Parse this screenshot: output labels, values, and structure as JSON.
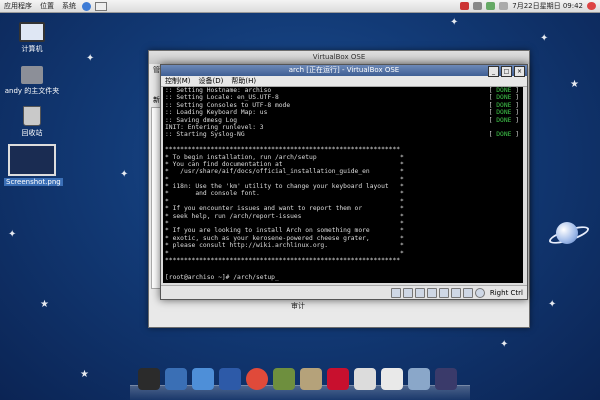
{
  "panel": {
    "menus": [
      "应用程序",
      "位置",
      "系统"
    ],
    "datetime": "7月22日星期日 09:42"
  },
  "desktop": {
    "icons": [
      {
        "label": "计算机",
        "icon": "computer-icon"
      },
      {
        "label": "andy 的主文件夹",
        "icon": "home-folder-icon"
      },
      {
        "label": "回收站",
        "icon": "trash-icon"
      },
      {
        "label": "Screenshot.png",
        "icon": "image-file-icon"
      }
    ]
  },
  "outer_window": {
    "title": "VirtualBox OSE",
    "menu_partial": "管理",
    "side_partial": "新",
    "detail_partial": "审计"
  },
  "vm_window": {
    "title": "arch [正在运行] - VirtualBox OSE",
    "menus": [
      "控制(M)",
      "设备(D)",
      "帮助(H)"
    ],
    "console_lines": [
      {
        "text": ":: Setting Hostname: archiso",
        "status": "DONE"
      },
      {
        "text": ":: Setting Locale: en_US.UTF-8",
        "status": "DONE"
      },
      {
        "text": ":: Setting Consoles to UTF-8 mode",
        "status": "DONE"
      },
      {
        "text": ":: Loading Keyboard Map: us",
        "status": "DONE"
      },
      {
        "text": ":: Saving dmesg Log",
        "status": "DONE"
      },
      {
        "text": "INIT: Entering runlevel: 3",
        "status": ""
      },
      {
        "text": ":: Starting Syslog-NG",
        "status": "DONE"
      },
      {
        "text": "",
        "status": ""
      },
      {
        "text": "**************************************************************",
        "status": ""
      },
      {
        "text": "* To begin installation, run /arch/setup                      *",
        "status": ""
      },
      {
        "text": "* You can find documentation at                               *",
        "status": ""
      },
      {
        "text": "*   /usr/share/aif/docs/official_installation_guide_en        *",
        "status": ""
      },
      {
        "text": "*                                                             *",
        "status": ""
      },
      {
        "text": "* i18n: Use the 'km' utility to change your keyboard layout   *",
        "status": ""
      },
      {
        "text": "*       and console font.                                     *",
        "status": ""
      },
      {
        "text": "*                                                             *",
        "status": ""
      },
      {
        "text": "* If you encounter issues and want to report them or          *",
        "status": ""
      },
      {
        "text": "* seek help, run /arch/report-issues                          *",
        "status": ""
      },
      {
        "text": "*                                                             *",
        "status": ""
      },
      {
        "text": "* If you are looking to install Arch on something more        *",
        "status": ""
      },
      {
        "text": "* exotic, such as your kerosene-powered cheese grater,        *",
        "status": ""
      },
      {
        "text": "* please consult http://wiki.archlinux.org.                   *",
        "status": ""
      },
      {
        "text": "*                                                             *",
        "status": ""
      },
      {
        "text": "**************************************************************",
        "status": ""
      }
    ],
    "prompt": "[root@archiso ~]# /arch/setup_",
    "host_key": "Right Ctrl"
  },
  "dock": {
    "icons": [
      "terminal-icon",
      "display-icon",
      "screenshot-icon",
      "users-icon",
      "chrome-icon",
      "files-icon",
      "folder-icon",
      "debian-icon",
      "edit-icon",
      "app-icon",
      "package-icon",
      "launcher-icon"
    ]
  },
  "colors": {
    "desktop": "#123a76",
    "done": "#3fc74a",
    "vm_title": "#4a6a9e"
  }
}
